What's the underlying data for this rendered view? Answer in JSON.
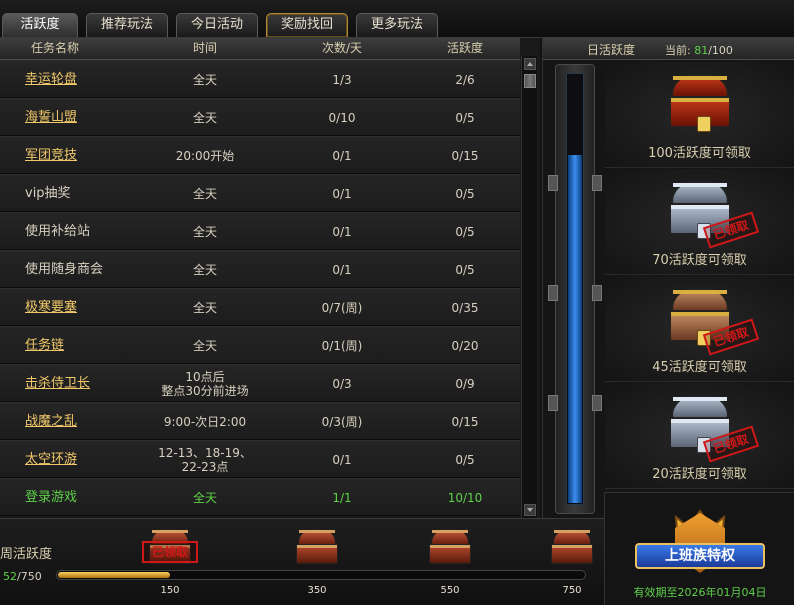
{
  "tabs": [
    {
      "label": "活跃度",
      "active": true
    },
    {
      "label": "推荐玩法",
      "active": false
    },
    {
      "label": "今日活动",
      "active": false
    },
    {
      "label": "奖励找回",
      "active": false,
      "highlight": true
    },
    {
      "label": "更多玩法",
      "active": false
    }
  ],
  "table": {
    "headers": [
      "任务名称",
      "时间",
      "次数/天",
      "活跃度"
    ],
    "rows": [
      {
        "name": "幸运轮盘",
        "time": "全天",
        "count": "1/3",
        "activity": "2/6",
        "link": true
      },
      {
        "name": "海誓山盟",
        "time": "全天",
        "count": "0/10",
        "activity": "0/5",
        "link": true
      },
      {
        "name": "军团竞技",
        "time": "20:00开始",
        "count": "0/1",
        "activity": "0/15",
        "link": true
      },
      {
        "name": "vip抽奖",
        "time": "全天",
        "count": "0/1",
        "activity": "0/5",
        "link": false
      },
      {
        "name": "使用补给站",
        "time": "全天",
        "count": "0/1",
        "activity": "0/5",
        "link": false
      },
      {
        "name": "使用随身商会",
        "time": "全天",
        "count": "0/1",
        "activity": "0/5",
        "link": false
      },
      {
        "name": "极寒要塞",
        "time": "全天",
        "count": "0/7(周)",
        "activity": "0/35",
        "link": true
      },
      {
        "name": "任务链",
        "time": "全天",
        "count": "0/1(周)",
        "activity": "0/20",
        "link": true
      },
      {
        "name": "击杀侍卫长",
        "time": "10点后\n整点30分前进场",
        "count": "0/3",
        "activity": "0/9",
        "link": true
      },
      {
        "name": "战魔之乱",
        "time": "9:00-次日2:00",
        "count": "0/3(周)",
        "activity": "0/15",
        "link": true
      },
      {
        "name": "太空环游",
        "time": "12-13、18-19、\n22-23点",
        "count": "0/1",
        "activity": "0/5",
        "link": true
      },
      {
        "name": "登录游戏",
        "time": "全天",
        "count": "1/1",
        "activity": "10/10",
        "link": false,
        "completed": true
      }
    ]
  },
  "daily": {
    "title": "日活跃度",
    "current_label": "当前:",
    "current": "81",
    "max": "/100",
    "fill_fraction": 0.81,
    "rewards": [
      {
        "label": "100活跃度可领取",
        "chest": "gold",
        "claimed": false
      },
      {
        "label": "70活跃度可领取",
        "chest": "silver",
        "claimed": true
      },
      {
        "label": "45活跃度可领取",
        "chest": "bronze",
        "claimed": true
      },
      {
        "label": "20活跃度可领取",
        "chest": "silver",
        "claimed": true
      }
    ],
    "claimed_stamp": "已领取"
  },
  "weekly": {
    "label": "周活跃度",
    "current": "52",
    "max": "/750",
    "fill_fraction": 0.212,
    "milestones": [
      "150",
      "350",
      "550",
      "750"
    ],
    "claimed_stamp": "已领取"
  },
  "vip": {
    "title": "上班族特权",
    "expiry": "有效期至2026年01月04日"
  },
  "colors": {
    "link": "#f2c96a",
    "completed": "#5ed04a",
    "stamp": "#d01818",
    "bar_blue": "#3a8ef0",
    "bar_gold": "#f8d060"
  }
}
